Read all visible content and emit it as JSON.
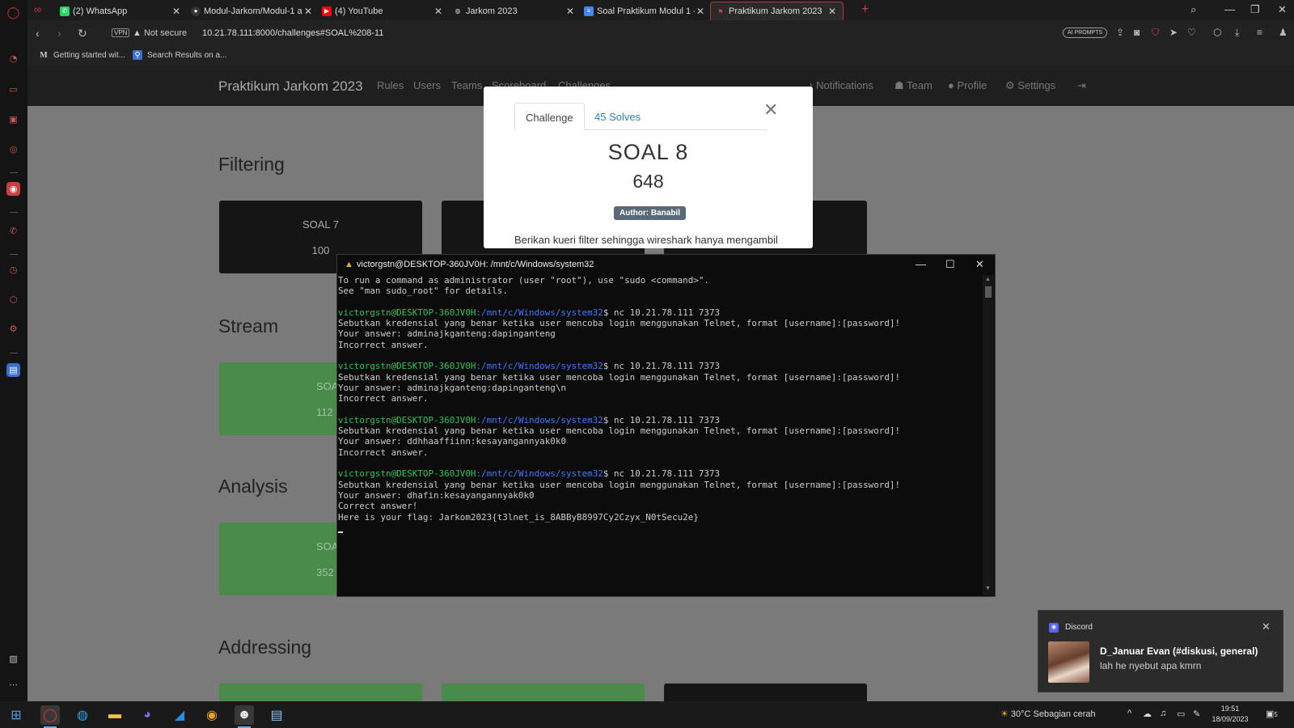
{
  "browser": {
    "tabs": [
      {
        "title": "(2) WhatsApp",
        "icon": "whatsapp-icon",
        "color": "#25d366"
      },
      {
        "title": "Modul-Jarkom/Modul-1 at",
        "icon": "github-icon",
        "color": "#ffffff"
      },
      {
        "title": "(4) YouTube",
        "icon": "youtube-icon",
        "color": "#ff0000"
      },
      {
        "title": "Jarkom 2023",
        "icon": "globe-icon",
        "color": "#cccccc"
      },
      {
        "title": "Soal Praktikum Modul 1 - G",
        "icon": "docs-icon",
        "color": "#4285f4"
      },
      {
        "title": "Praktikum Jarkom 2023",
        "icon": "ctfd-flag-icon",
        "color": "#d04050"
      }
    ],
    "security_label": "Not secure",
    "vpn_label": "VPN",
    "url": "10.21.78.111:8000/challenges#SOAL%208-11",
    "ai_prompts_label": "AI PROMPTS",
    "bookmarks": [
      {
        "label": "Getting started wit...",
        "icon": "medium-icon"
      },
      {
        "label": "Search Results on a...",
        "icon": "search-results-icon"
      }
    ]
  },
  "site": {
    "brand": "Praktikum Jarkom 2023",
    "nav_left": [
      "Rules",
      "Users",
      "Teams",
      "Scoreboard",
      "Challenges"
    ],
    "nav_right": [
      "Notifications",
      "Team",
      "Profile",
      "Settings"
    ],
    "sections": [
      {
        "title": "Filtering",
        "cards": [
          {
            "name": "SOAL 7",
            "value": "100",
            "solved": false
          }
        ]
      },
      {
        "title": "Stream",
        "cards": [
          {
            "name": "SOAL",
            "value": "112",
            "solved": true
          }
        ]
      },
      {
        "title": "Analysis",
        "cards": [
          {
            "name": "SOAL",
            "value": "352",
            "solved": true
          }
        ]
      },
      {
        "title": "Addressing",
        "cards": []
      }
    ]
  },
  "modal": {
    "tab_challenge": "Challenge",
    "tab_solves": "45 Solves",
    "title": "SOAL 8",
    "value": "648",
    "author": "Author: Banabil",
    "description": "Berikan kueri filter sehingga wireshark hanya mengambil"
  },
  "terminal": {
    "title": "victorgstn@DESKTOP-360JV0H: /mnt/c/Windows/system32",
    "prompt_user": "victorgstn@DESKTOP-360JV0H",
    "prompt_path": ":/mnt/c/Windows/system32",
    "lines": [
      {
        "t": "To run a command as administrator (user \"root\"), use \"sudo <command>\"."
      },
      {
        "t": "See \"man sudo_root\" for details."
      },
      {
        "t": ""
      },
      {
        "prompt": true,
        "t": "$ nc 10.21.78.111 7373"
      },
      {
        "t": "Sebutkan kredensial yang benar ketika user mencoba login menggunakan Telnet, format [username]:[password]!"
      },
      {
        "t": "Your answer: adminajkganteng:dapinganteng"
      },
      {
        "t": "Incorrect answer."
      },
      {
        "t": ""
      },
      {
        "prompt": true,
        "t": "$ nc 10.21.78.111 7373"
      },
      {
        "t": "Sebutkan kredensial yang benar ketika user mencoba login menggunakan Telnet, format [username]:[password]!"
      },
      {
        "t": "Your answer: adminajkganteng:dapinganteng\\n"
      },
      {
        "t": "Incorrect answer."
      },
      {
        "t": ""
      },
      {
        "prompt": true,
        "t": "$ nc 10.21.78.111 7373"
      },
      {
        "t": "Sebutkan kredensial yang benar ketika user mencoba login menggunakan Telnet, format [username]:[password]!"
      },
      {
        "t": "Your answer: ddhhaaffiinn:kesayangannyak0k0"
      },
      {
        "t": "Incorrect answer."
      },
      {
        "t": ""
      },
      {
        "prompt": true,
        "t": "$ nc 10.21.78.111 7373"
      },
      {
        "t": "Sebutkan kredensial yang benar ketika user mencoba login menggunakan Telnet, format [username]:[password]!"
      },
      {
        "t": "Your answer: dhafin:kesayangannyak0k0"
      },
      {
        "t": "Correct answer!"
      },
      {
        "t": "Here is your flag: Jarkom2023{t3lnet_is_8ABByB8997Cy2Czyx_N0tSecu2e}"
      }
    ]
  },
  "notification": {
    "app": "Discord",
    "title": "D_Januar Evan (#diskusi, general)",
    "message": "lah he nyebut apa kmrn"
  },
  "taskbar": {
    "weather": "30°C  Sebagian cerah",
    "time": "19:51",
    "date": "18/09/2023",
    "notification_count": "5"
  }
}
